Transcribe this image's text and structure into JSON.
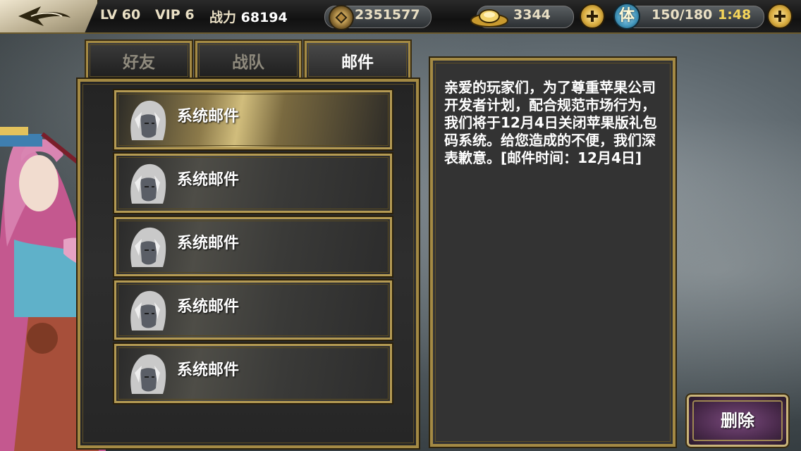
{
  "topbar": {
    "level": "LV 60",
    "vip": "VIP 6",
    "power_label": "战力",
    "power_value": "68194",
    "coins": "2351577",
    "ingots": "3344",
    "stamina_icon_char": "体",
    "stamina": "150/180",
    "timer": "1:48"
  },
  "tabs": [
    {
      "label": "好友",
      "active": false
    },
    {
      "label": "战队",
      "active": false
    },
    {
      "label": "邮件",
      "active": true
    }
  ],
  "mails": [
    {
      "title": "系统邮件",
      "selected": true
    },
    {
      "title": "系统邮件",
      "selected": false
    },
    {
      "title": "系统邮件",
      "selected": false
    },
    {
      "title": "系统邮件",
      "selected": false
    },
    {
      "title": "系统邮件",
      "selected": false
    }
  ],
  "message": {
    "body": "亲爱的玩家们，为了尊重苹果公司开发者计划，配合规范市场行为，我们将于12月4日关闭苹果版礼包码系统。给您造成的不便，我们深表歉意。[邮件时间：12月4日]"
  },
  "delete_button": "删除",
  "colors": {
    "gold_frame": "#a48a44",
    "panel_bg": "#333333",
    "delete_bg": "#4a2a4c",
    "timer": "#f5d55a"
  },
  "icons": [
    "back-arrow-icon",
    "coin-icon",
    "gold-ingot-icon",
    "plus-icon",
    "stamina-icon",
    "avatar-icon"
  ]
}
